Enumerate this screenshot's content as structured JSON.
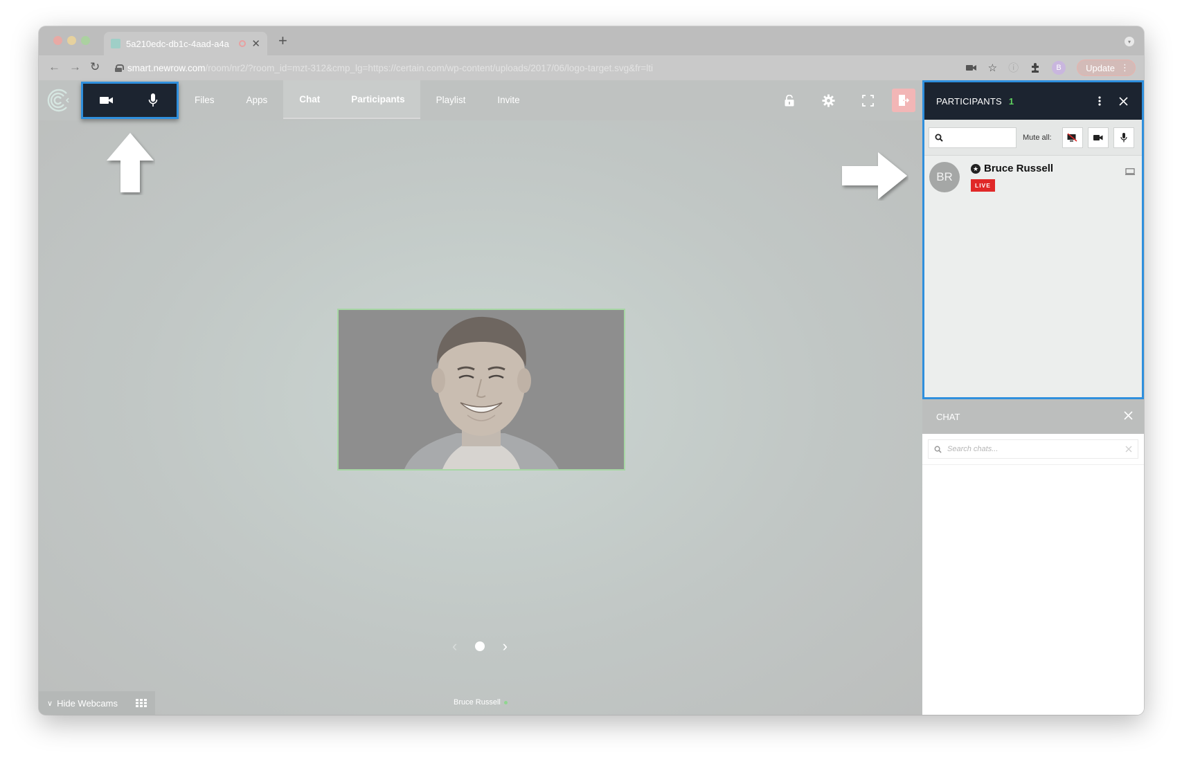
{
  "browser": {
    "tab_title": "5a210edc-db1c-4aad-a4a",
    "url_host": "smart.newrow.com",
    "url_path": "/room/nr2/?room_id=mzt-312&cmp_lg=https://certain.com/wp-content/uploads/2017/06/logo-target.svg&fr=lti",
    "profile_initial": "B",
    "update_label": "Update"
  },
  "nav": {
    "items": [
      {
        "label": "Files"
      },
      {
        "label": "Apps"
      },
      {
        "label": "Chat"
      },
      {
        "label": "Participants"
      },
      {
        "label": "Playlist"
      },
      {
        "label": "Invite"
      }
    ]
  },
  "stage": {
    "speaker_name": "Bruce Russell"
  },
  "bottombar": {
    "hide_webcams_label": "Hide Webcams"
  },
  "participants_panel": {
    "title": "PARTICIPANTS",
    "count": "1",
    "mute_all_label": "Mute all:",
    "participants": [
      {
        "initials": "BR",
        "name": "Bruce Russell",
        "status": "LIVE"
      }
    ]
  },
  "chat_panel": {
    "title": "CHAT",
    "search_placeholder": "Search chats..."
  },
  "colors": {
    "highlight_border": "#2f8fdd",
    "panel_header": "#1c2430",
    "live_badge": "#e02828",
    "count_green": "#5fd35f"
  }
}
